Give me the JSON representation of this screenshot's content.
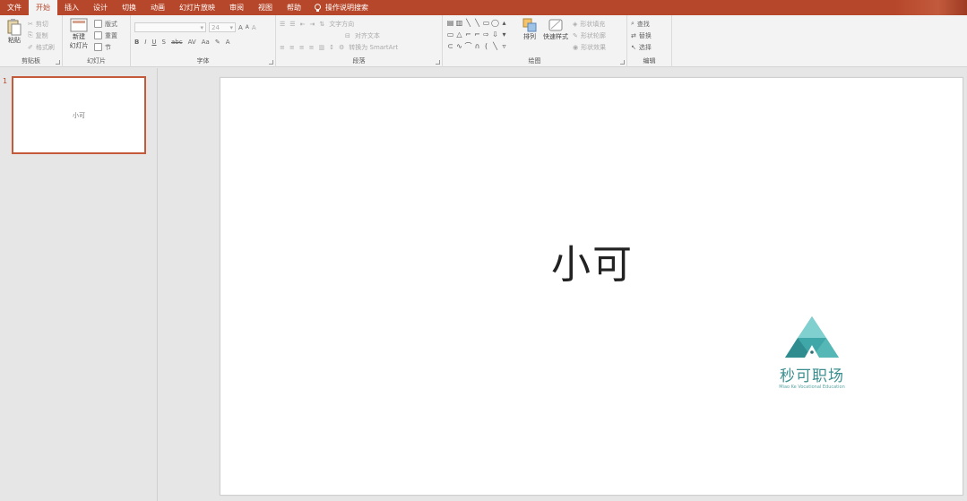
{
  "tabs": [
    {
      "label": "文件",
      "active": false
    },
    {
      "label": "开始",
      "active": true
    },
    {
      "label": "插入",
      "active": false
    },
    {
      "label": "设计",
      "active": false
    },
    {
      "label": "切换",
      "active": false
    },
    {
      "label": "动画",
      "active": false
    },
    {
      "label": "幻灯片放映",
      "active": false
    },
    {
      "label": "审阅",
      "active": false
    },
    {
      "label": "视图",
      "active": false
    },
    {
      "label": "帮助",
      "active": false
    }
  ],
  "tell_me": "操作说明搜索",
  "ribbon": {
    "clipboard": {
      "paste": "粘贴",
      "cut": "剪切",
      "copy": "复制",
      "format_painter": "格式刷",
      "label": "剪贴板"
    },
    "slides": {
      "new_slide": "新建",
      "new_slide_2": "幻灯片",
      "layout": "版式",
      "reset": "重置",
      "section": "节",
      "label": "幻灯片"
    },
    "font": {
      "size": "24",
      "bold": "B",
      "italic": "I",
      "underline": "U",
      "shadow": "S",
      "strike": "abc",
      "spacing": "AV",
      "case": "Aa",
      "grow": "A",
      "shrink": "A",
      "clear": "A",
      "label": "字体"
    },
    "paragraph": {
      "text_direction": "文字方向",
      "align_text": "对齐文本",
      "smartart": "转换为 SmartArt",
      "label": "段落"
    },
    "drawing": {
      "arrange": "排列",
      "quick_styles": "快速样式",
      "shape_fill": "形状填充",
      "shape_outline": "形状轮廓",
      "shape_effects": "形状效果",
      "label": "绘图"
    },
    "editing": {
      "find": "查找",
      "replace": "替换",
      "select": "选择",
      "label": "编辑"
    }
  },
  "thumbnail": {
    "number": "1",
    "title": "小可"
  },
  "slide": {
    "title": "小可"
  },
  "logo": {
    "name": "秒可职场",
    "tagline": "Miao Ke Vocational Education"
  },
  "colors": {
    "accent": "#b7472a",
    "logo": "#3d9a9a"
  }
}
